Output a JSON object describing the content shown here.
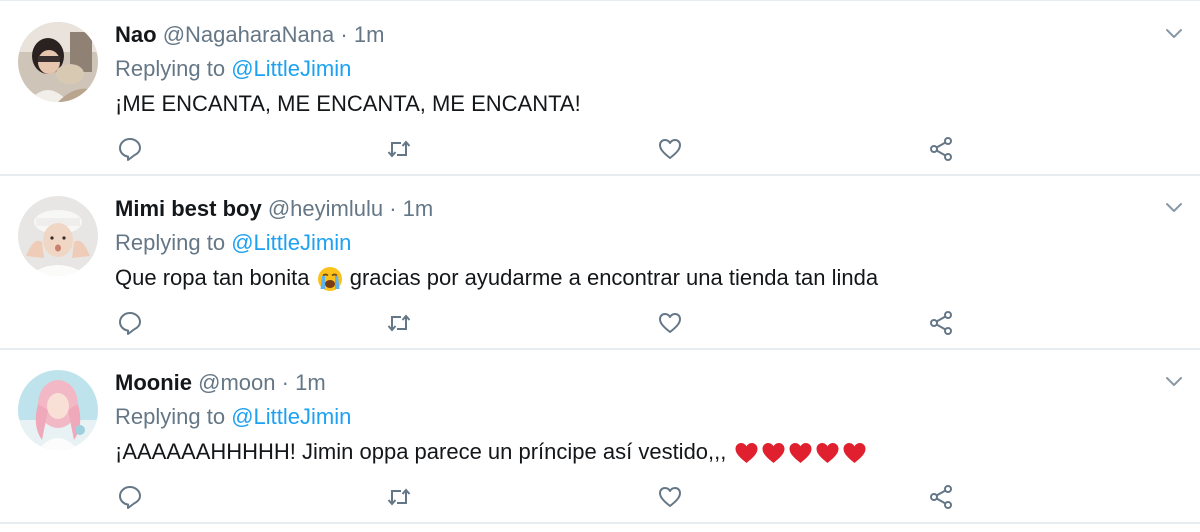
{
  "tweets": [
    {
      "display_name": "Nao",
      "handle": "@NagaharaNana",
      "separator": "·",
      "time": "1m",
      "reply_prefix": "Replying to",
      "reply_to": "@LittleJimin",
      "text": "¡ME ENCANTA, ME ENCANTA, ME ENCANTA!",
      "text_after_emoji": "",
      "avatar_icon": "user-photo-avatar"
    },
    {
      "display_name": "Mimi best boy",
      "handle": "@heyimlulu",
      "separator": "·",
      "time": "1m",
      "reply_prefix": "Replying to",
      "reply_to": "@LittleJimin",
      "text": "Que ropa tan bonita",
      "emoji": "crying-face-emoji",
      "text_after_emoji": "gracias por ayudarme a encontrar una tienda tan linda",
      "avatar_icon": "user-photo-avatar"
    },
    {
      "display_name": "Moonie",
      "handle": "@moon",
      "separator": "·",
      "time": "1m",
      "reply_prefix": "Replying to",
      "reply_to": "@LittleJimin",
      "text": "¡AAAAAAHHHHH! Jimin oppa parece un príncipe así vestido,,,",
      "emoji": "red-heart-emoji",
      "emoji_count": 5,
      "avatar_icon": "user-photo-avatar"
    }
  ],
  "icons": {
    "reply": "reply-icon",
    "retweet": "retweet-icon",
    "like": "heart-icon",
    "share": "share-icon",
    "menu": "chevron-down-icon"
  },
  "colors": {
    "text": "#14171a",
    "muted": "#657786",
    "link": "#1da1f2",
    "divider": "#e6ecf0",
    "heart": "#e0202e"
  }
}
